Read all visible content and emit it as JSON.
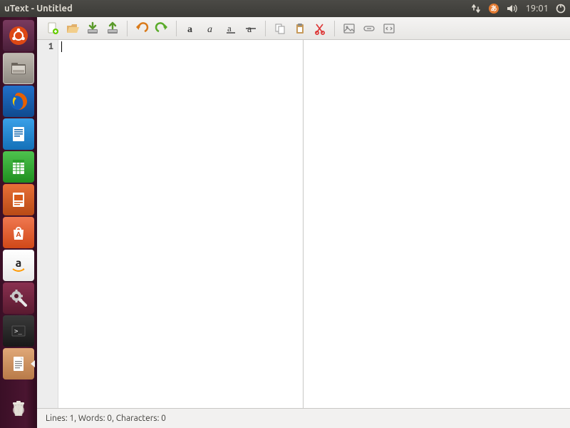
{
  "menubar": {
    "title": "uText - Untitled",
    "clock": "19:01"
  },
  "launcher": {
    "items": [
      {
        "name": "dash",
        "color": "#5a2a4a",
        "icon": "ubuntu"
      },
      {
        "name": "files",
        "color": "#9b9691",
        "icon": "files",
        "active": true
      },
      {
        "name": "firefox",
        "color": "#1a6bc7",
        "icon": "firefox"
      },
      {
        "name": "writer",
        "color": "#1f8fe0",
        "icon": "writer"
      },
      {
        "name": "calc",
        "color": "#2eae2e",
        "icon": "calc"
      },
      {
        "name": "impress",
        "color": "#d85a1a",
        "icon": "impress"
      },
      {
        "name": "software-center",
        "color": "#e95420",
        "icon": "bag"
      },
      {
        "name": "amazon",
        "color": "#ffffff",
        "icon": "amazon"
      },
      {
        "name": "system-settings",
        "color": "#7a2640",
        "icon": "gear-wrench"
      },
      {
        "name": "terminal",
        "color": "#2b2b2b",
        "icon": "terminal"
      },
      {
        "name": "utext",
        "color": "#d08a5a",
        "icon": "doc",
        "running": true
      }
    ],
    "trash": {
      "name": "trash",
      "icon": "trash"
    }
  },
  "toolbar": {
    "groups": [
      [
        "new-file",
        "open-file",
        "save-file",
        "save-as"
      ],
      [
        "undo",
        "redo"
      ],
      [
        "bold",
        "italic",
        "underline",
        "strikethrough"
      ],
      [
        "copy",
        "paste",
        "cut"
      ],
      [
        "insert-image",
        "insert-link",
        "insert-code"
      ]
    ]
  },
  "editor": {
    "line_number": "1",
    "content": ""
  },
  "statusbar": {
    "text": "Lines: 1, Words: 0, Characters: 0"
  }
}
